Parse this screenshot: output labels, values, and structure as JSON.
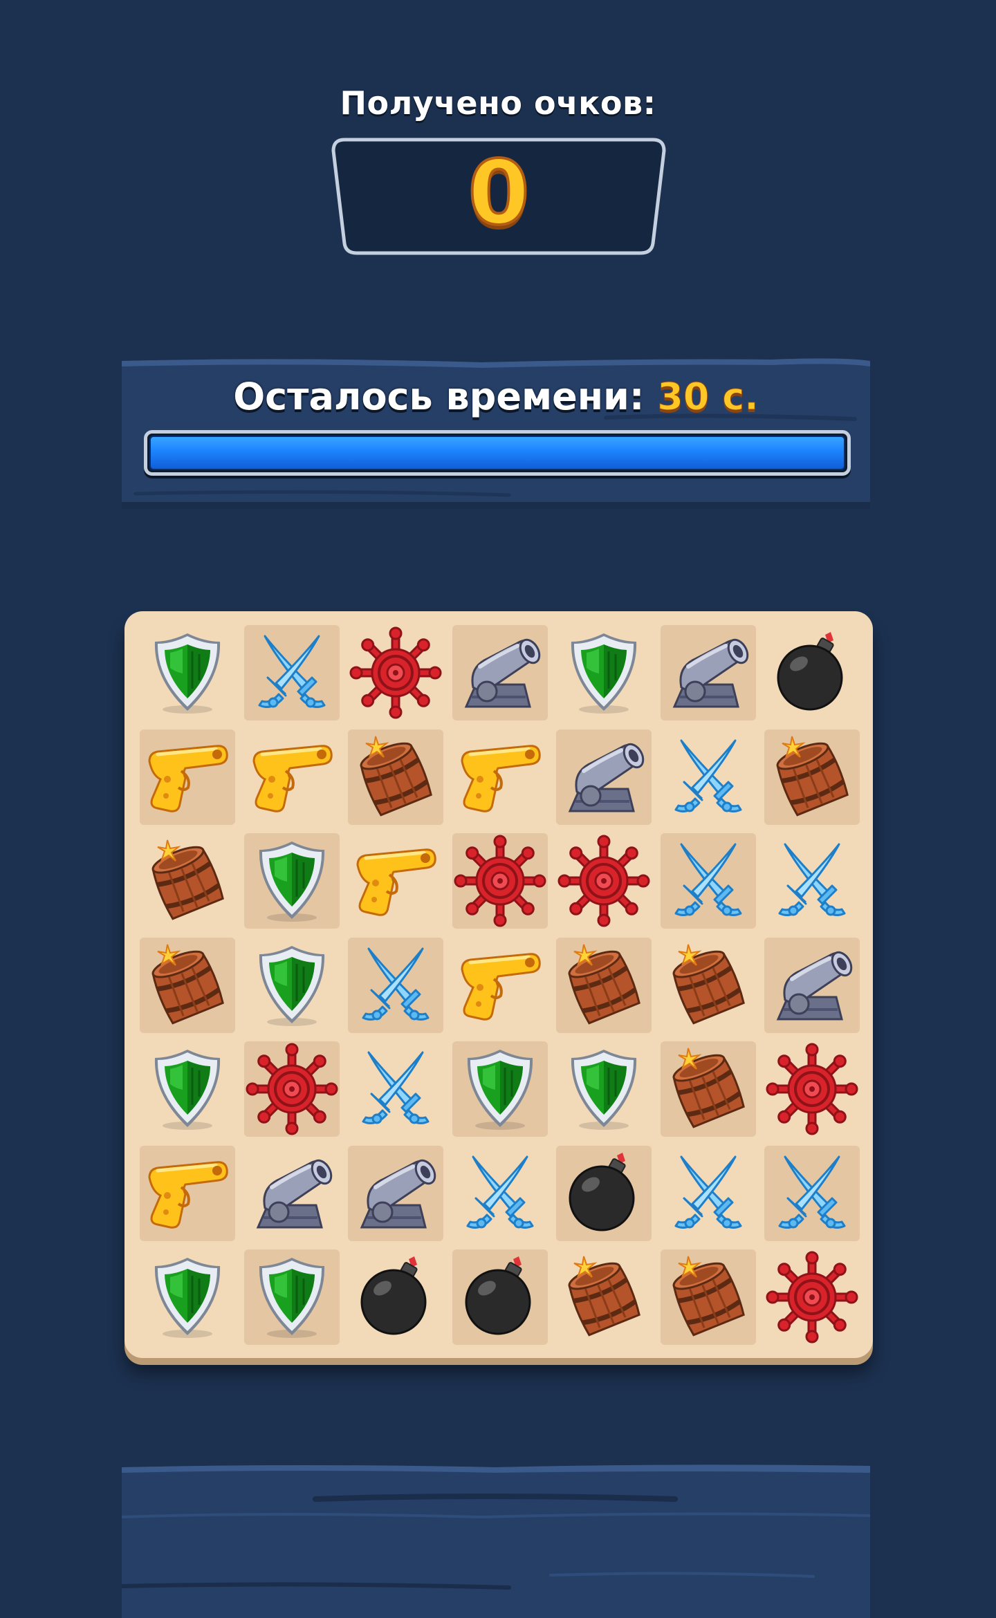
{
  "score": {
    "label": "Получено очков:",
    "value": "0"
  },
  "timer": {
    "label": "Осталось времени:",
    "value": "30 с.",
    "progress_fraction": 1.0
  },
  "board": {
    "rows": 7,
    "columns": 7,
    "grid": [
      [
        "shield",
        "swords",
        "wheel",
        "cannon",
        "shield",
        "cannon",
        "bomb"
      ],
      [
        "pistol",
        "pistol",
        "barrel",
        "pistol",
        "cannon",
        "swords",
        "barrel"
      ],
      [
        "barrel",
        "shield",
        "pistol",
        "wheel",
        "wheel",
        "swords",
        "swords"
      ],
      [
        "barrel",
        "shield",
        "swords",
        "pistol",
        "barrel",
        "barrel",
        "cannon"
      ],
      [
        "shield",
        "wheel",
        "swords",
        "shield",
        "shield",
        "barrel",
        "wheel"
      ],
      [
        "pistol",
        "cannon",
        "cannon",
        "swords",
        "bomb",
        "swords",
        "swords"
      ],
      [
        "shield",
        "shield",
        "bomb",
        "bomb",
        "barrel",
        "barrel",
        "wheel"
      ]
    ]
  },
  "colors": {
    "background": "#1c3150",
    "panel": "#263f67",
    "gold_text": "#ffc726",
    "progress_fill": "#1f86ff",
    "board": "#f2d9b8"
  }
}
